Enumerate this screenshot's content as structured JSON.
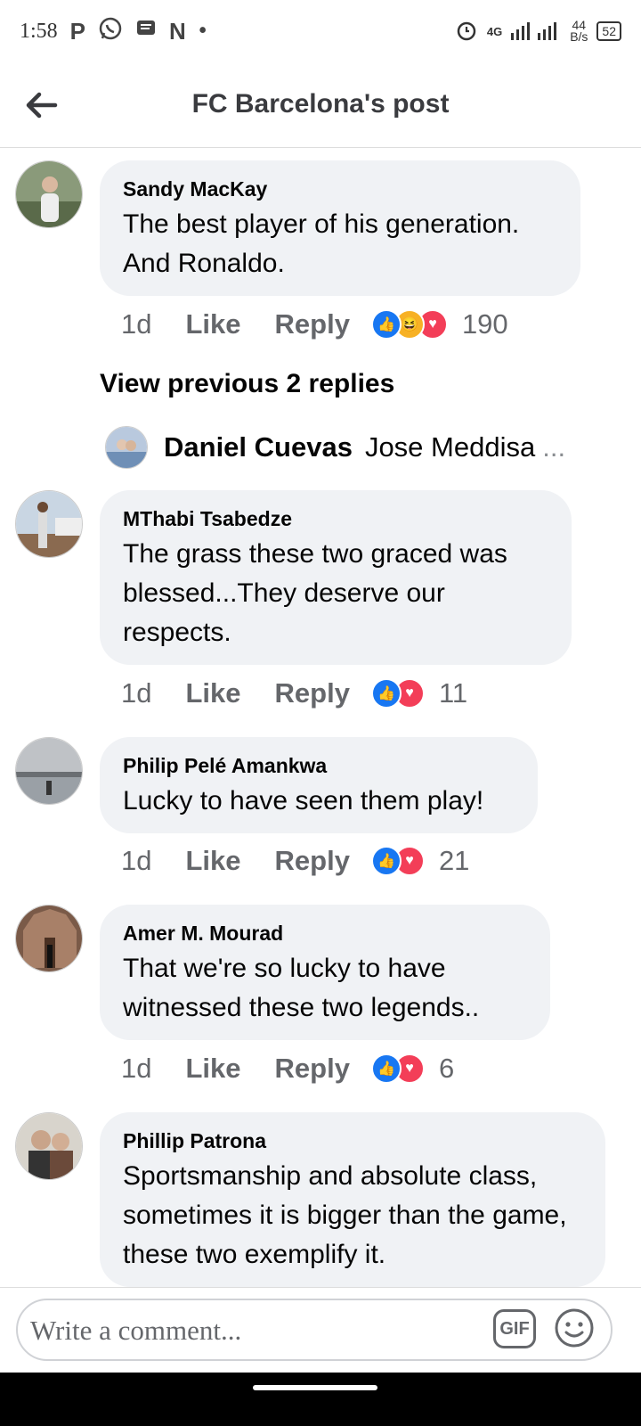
{
  "status_bar": {
    "time": "1:58",
    "app_icons": [
      "P",
      "whatsapp-icon",
      "message-icon",
      "N",
      "•"
    ],
    "network": "4G",
    "speed_value": "44",
    "speed_unit": "B/s",
    "battery": "52"
  },
  "header": {
    "title": "FC Barcelona's post"
  },
  "comments": [
    {
      "name": "Sandy MacKay",
      "text": "The best player of his generation. And Ronaldo.",
      "time": "1d",
      "like": "Like",
      "reply": "Reply",
      "reactions": [
        "like",
        "haha",
        "love"
      ],
      "count": "190"
    },
    {
      "name": "MThabi Tsabedze",
      "text": "The grass these two graced was blessed...They deserve our respects.",
      "time": "1d",
      "like": "Like",
      "reply": "Reply",
      "reactions": [
        "like",
        "love"
      ],
      "count": "11"
    },
    {
      "name": "Philip Pelé Amankwa",
      "text": "Lucky to have seen them play!",
      "time": "1d",
      "like": "Like",
      "reply": "Reply",
      "reactions": [
        "like",
        "love"
      ],
      "count": "21"
    },
    {
      "name": "Amer M. Mourad",
      "text": "That we're so lucky to have witnessed these two legends..",
      "time": "1d",
      "like": "Like",
      "reply": "Reply",
      "reactions": [
        "like",
        "love"
      ],
      "count": "6"
    },
    {
      "name": "Phillip Patrona",
      "text": "Sportsmanship and absolute class, sometimes it is bigger than the game, these two exemplify it."
    }
  ],
  "replies": {
    "view_previous": "View previous 2 replies",
    "preview_name": "Daniel Cuevas",
    "preview_text": "Jose Meddisa",
    "preview_ellipsis": "..."
  },
  "composer": {
    "placeholder": "Write a comment...",
    "gif_label": "GIF"
  },
  "colors": {
    "bubble": "#f0f2f5",
    "meta": "#65676b",
    "like_blue": "#1877f2",
    "love_red": "#f33e58",
    "haha_yellow": "#f7b125"
  }
}
